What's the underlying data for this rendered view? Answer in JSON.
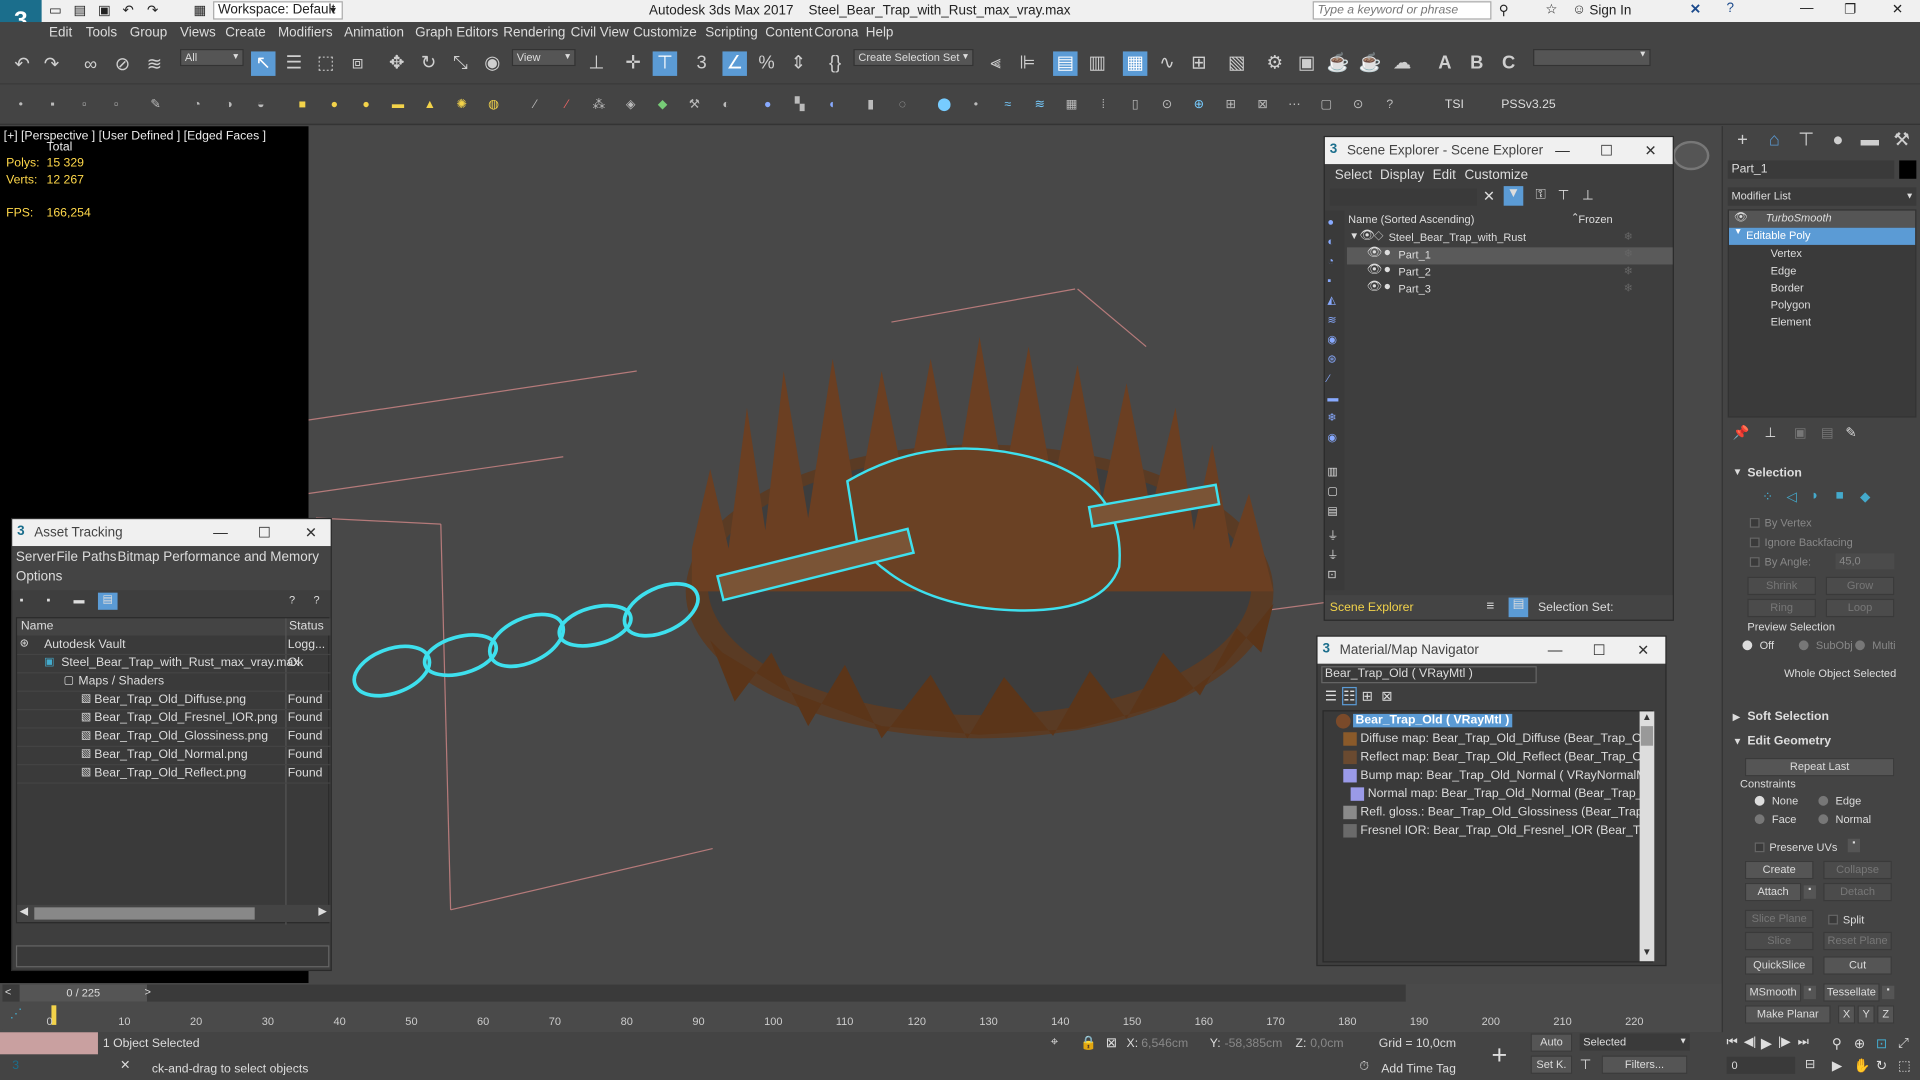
{
  "app": {
    "title": "Autodesk 3ds Max 2017",
    "file": "Steel_Bear_Trap_with_Rust_max_vray.max",
    "workspace": "Workspace: Default",
    "search_placeholder": "Type a keyword or phrase",
    "sign_in": "Sign In",
    "app_letter": "3"
  },
  "menu": [
    "Edit",
    "Tools",
    "Group",
    "Views",
    "Create",
    "Modifiers",
    "Animation",
    "Graph Editors",
    "Rendering",
    "Civil View",
    "Customize",
    "Scripting",
    "Content",
    "Corona",
    "Help"
  ],
  "toolbar": {
    "filter": "All",
    "ref_coord": "View",
    "selection_set": "Create Selection Set",
    "tsi": "TSI",
    "pss": "PSSv3.25"
  },
  "viewport": {
    "label": "[+] [Perspective ] [User Defined ] [Edged Faces ]",
    "total": "Total",
    "polys_label": "Polys:",
    "polys": "15 329",
    "verts_label": "Verts:",
    "verts": "12 267",
    "fps_label": "FPS:",
    "fps": "166,254"
  },
  "scene_explorer": {
    "title": "Scene Explorer - Scene Explorer",
    "menu": [
      "Select",
      "Display",
      "Edit",
      "Customize"
    ],
    "col_name": "Name (Sorted Ascending)",
    "col_frozen": "Frozen",
    "root": "Steel_Bear_Trap_with_Rust",
    "children": [
      "Part_1",
      "Part_2",
      "Part_3"
    ],
    "footer_left": "Scene Explorer",
    "footer_right": "Selection Set:"
  },
  "asset_tracking": {
    "title": "Asset Tracking",
    "menu": [
      "Server",
      "File",
      "Paths",
      "Bitmap Performance and Memory"
    ],
    "menu2": "Options",
    "col_name": "Name",
    "col_status": "Status",
    "rows": [
      {
        "name": "Autodesk Vault",
        "status": "Logg..."
      },
      {
        "name": "Steel_Bear_Trap_with_Rust_max_vray.max",
        "status": "Ok"
      },
      {
        "name": "Maps / Shaders",
        "status": ""
      },
      {
        "name": "Bear_Trap_Old_Diffuse.png",
        "status": "Found"
      },
      {
        "name": "Bear_Trap_Old_Fresnel_IOR.png",
        "status": "Found"
      },
      {
        "name": "Bear_Trap_Old_Glossiness.png",
        "status": "Found"
      },
      {
        "name": "Bear_Trap_Old_Normal.png",
        "status": "Found"
      },
      {
        "name": "Bear_Trap_Old_Reflect.png",
        "status": "Found"
      }
    ]
  },
  "material_nav": {
    "title": "Material/Map Navigator",
    "field": "Bear_Trap_Old  ( VRayMtl )",
    "root": "Bear_Trap_Old  ( VRayMtl )",
    "items": [
      "Diffuse map: Bear_Trap_Old_Diffuse (Bear_Trap_Old_Diffuse",
      "Reflect map: Bear_Trap_Old_Reflect (Bear_Trap_Old_Reflect",
      "Bump map: Bear_Trap_Old_Normal  ( VRayNormalMap )",
      "Normal map: Bear_Trap_Old_Normal (Bear_Trap_Old_Norm",
      "Refl. gloss.: Bear_Trap_Old_Glossiness (Bear_Trap_Old_Gloss",
      "Fresnel IOR: Bear_Trap_Old_Fresnel_IOR (Bear_Trap_Old_Fr"
    ]
  },
  "command_panel": {
    "object_name": "Part_1",
    "modifier_list": "Modifier List",
    "stack": [
      "TurboSmooth",
      "Editable Poly",
      "Vertex",
      "Edge",
      "Border",
      "Polygon",
      "Element"
    ],
    "selection": {
      "title": "Selection",
      "by_vertex": "By Vertex",
      "ignore_backfacing": "Ignore Backfacing",
      "by_angle": "By Angle:",
      "angle": "45,0",
      "shrink": "Shrink",
      "grow": "Grow",
      "ring": "Ring",
      "loop": "Loop",
      "preview": "Preview Selection",
      "off": "Off",
      "subobj": "SubObj",
      "multi": "Multi",
      "whole": "Whole Object Selected"
    },
    "soft_selection": "Soft Selection",
    "edit_geometry": {
      "title": "Edit Geometry",
      "repeat_last": "Repeat Last",
      "constraints": "Constraints",
      "none": "None",
      "edge": "Edge",
      "face": "Face",
      "normal": "Normal",
      "preserve_uvs": "Preserve UVs",
      "create": "Create",
      "collapse": "Collapse",
      "attach": "Attach",
      "detach": "Detach",
      "slice_plane": "Slice Plane",
      "split": "Split",
      "slice": "Slice",
      "reset_plane": "Reset Plane",
      "quickslice": "QuickSlice",
      "cut": "Cut",
      "msmooth": "MSmooth",
      "tessellate": "Tessellate",
      "make_planar": "Make Planar",
      "x": "X",
      "y": "Y",
      "z": "Z"
    }
  },
  "timeline": {
    "frame": "0 / 225",
    "ticks": [
      "0",
      "10",
      "20",
      "30",
      "40",
      "50",
      "60",
      "70",
      "80",
      "90",
      "100",
      "110",
      "120",
      "130",
      "140",
      "150",
      "160",
      "170",
      "180",
      "190",
      "200",
      "210",
      "220"
    ]
  },
  "status": {
    "selected": "1 Object Selected",
    "prompt": "ck-and-drag to select objects",
    "x_label": "X:",
    "x": "6,546cm",
    "y_label": "Y:",
    "y": "-58,385cm",
    "z_label": "Z:",
    "z": "0,0cm",
    "grid": "Grid = 10,0cm",
    "add_time_tag": "Add Time Tag",
    "auto": "Auto",
    "set_k": "Set K.",
    "key_mode": "Selected",
    "filters": "Filters...",
    "frame_field": "0"
  }
}
